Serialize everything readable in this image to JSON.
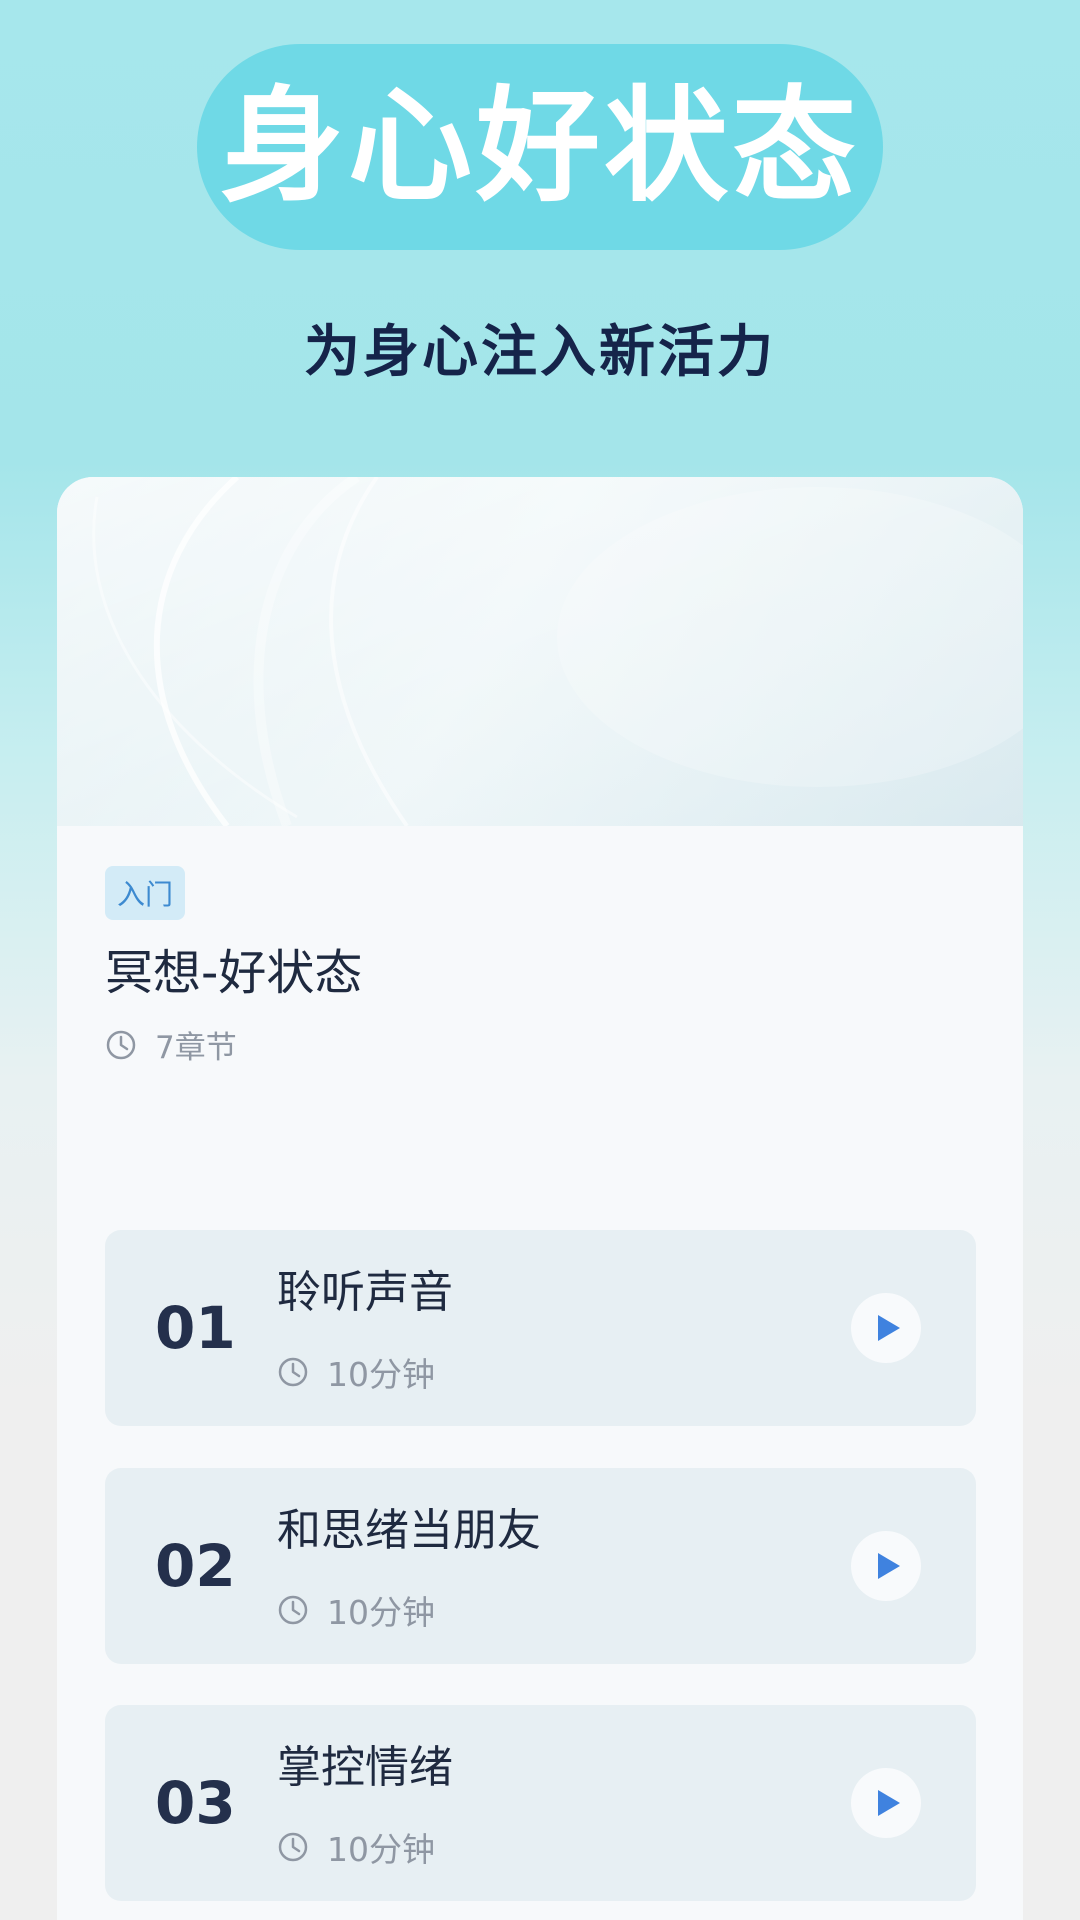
{
  "hero": {
    "title": "身心好状态",
    "subtitle": "为身心注入新活力"
  },
  "course": {
    "tag": "入门",
    "title": "冥想-好状态",
    "chapters": "7章节",
    "lessons": [
      {
        "number": "01",
        "title": "聆听声音",
        "duration": "10分钟"
      },
      {
        "number": "02",
        "title": "和思绪当朋友",
        "duration": "10分钟"
      },
      {
        "number": "03",
        "title": "掌控情绪",
        "duration": "10分钟"
      }
    ]
  },
  "colors": {
    "background_top": "#a6e7ec",
    "pill": "#6fd9e6",
    "title_text": "#15244a",
    "accent_blue": "#3f82df",
    "muted_text": "#8f97a3"
  },
  "icons": {
    "clock": "clock-icon",
    "play": "play-icon"
  }
}
